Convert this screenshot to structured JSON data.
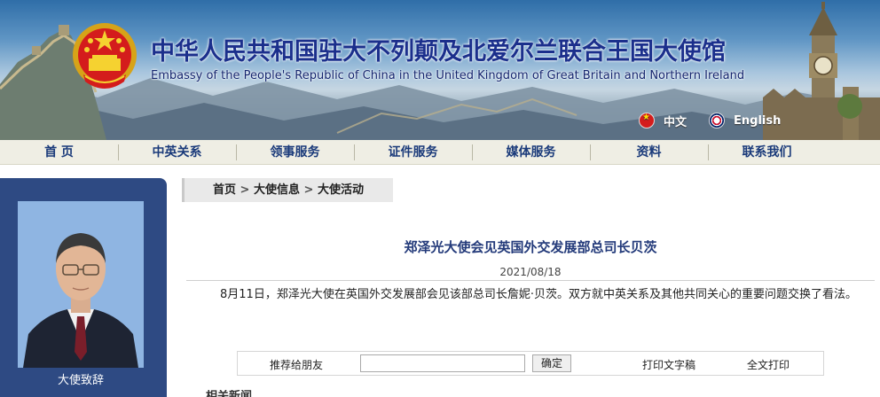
{
  "header": {
    "title_cn": "中华人民共和国驻大不列颠及北爱尔兰联合王国大使馆",
    "title_en": "Embassy of the People's Republic of China in the United Kingdom of Great Britain and Northern Ireland",
    "lang_cn": "中文",
    "lang_en": "English"
  },
  "nav": {
    "items": [
      {
        "label": "首 页"
      },
      {
        "label": "中英关系"
      },
      {
        "label": "领事服务"
      },
      {
        "label": "证件服务"
      },
      {
        "label": "媒体服务"
      },
      {
        "label": "资料"
      },
      {
        "label": "联系我们"
      }
    ]
  },
  "sidebar": {
    "caption": "大使致辞"
  },
  "breadcrumb": {
    "home": "首页",
    "sep": ">",
    "section": "大使信息",
    "current": "大使活动"
  },
  "article": {
    "title": "郑泽光大使会见英国外交发展部总司长贝茨",
    "date": "2021/08/18",
    "body": "8月11日，郑泽光大使在英国外交发展部会见该部总司长詹妮·贝茨。双方就中英关系及其他共同关心的重要问题交换了看法。"
  },
  "share": {
    "label": "推荐给朋友",
    "input_value": "",
    "button": "确定",
    "print_text": "打印文字稿",
    "print_full": "全文打印"
  },
  "related": {
    "title": "相关新闻"
  },
  "colors": {
    "nav_text": "#1a3a7a",
    "sidebar_bg": "#2e4a83",
    "title_text": "#233a7a"
  },
  "icons": {
    "emblem": "national-emblem-icon",
    "flag_cn": "china-flag-icon",
    "flag_uk": "uk-flag-icon"
  }
}
